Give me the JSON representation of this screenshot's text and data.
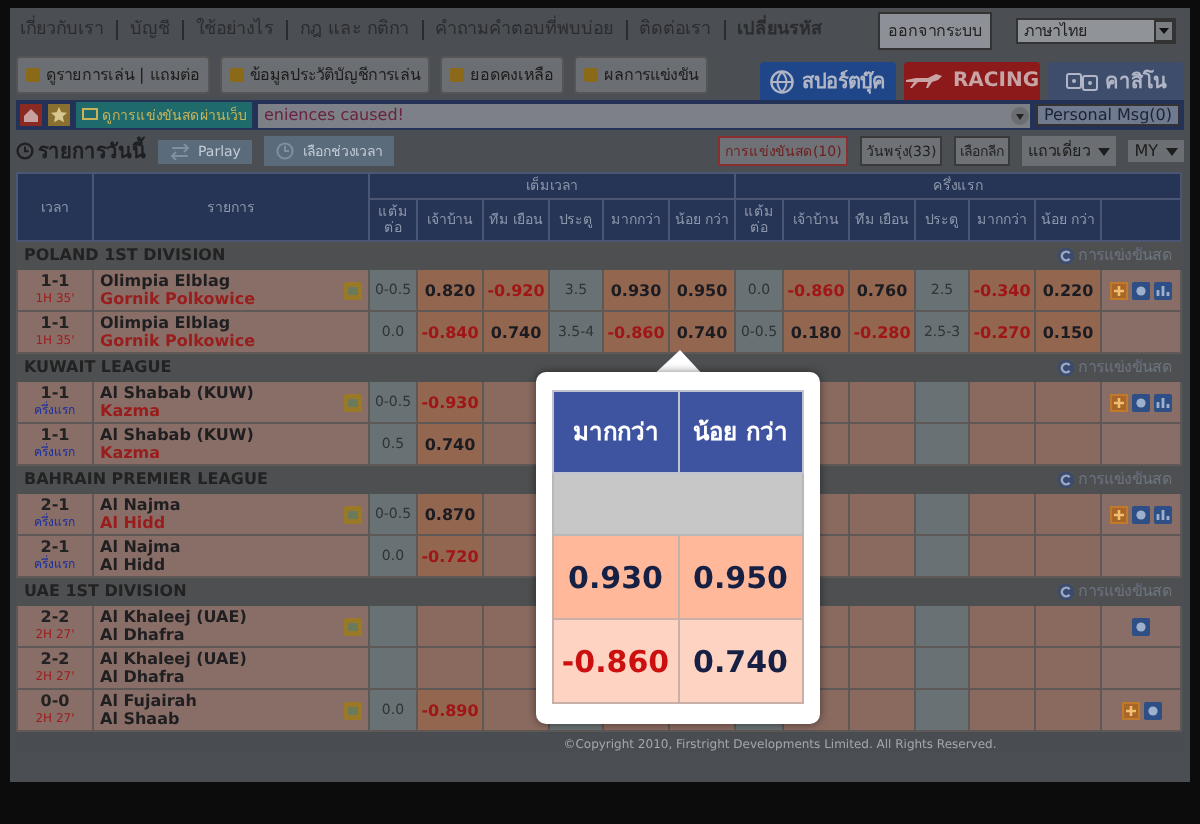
{
  "nav": {
    "links": [
      {
        "label": "เกี่ยวกับเรา",
        "selected": false
      },
      {
        "label": "บัญชี",
        "selected": false
      },
      {
        "label": "ใช้อย่างไร",
        "selected": false
      },
      {
        "label": "กฎ และ กติกา",
        "selected": false
      },
      {
        "label": "คำถามคำตอบที่พบบ่อย",
        "selected": false
      },
      {
        "label": "ติดต่อเรา",
        "selected": false
      },
      {
        "label": "เปลี่ยนรหัส",
        "selected": true
      }
    ],
    "logout": "ออกจากระบบ",
    "language": "ภาษาไทย"
  },
  "toolbar": {
    "buttons": [
      "ดูรายการเล่น | แถมต่อ",
      "ข้อมูลประวัติบัญชีการเล่น",
      "ยอดคงเหลือ",
      "ผลการแข่งขัน"
    ],
    "products": [
      {
        "kind": "sports",
        "label": "สปอร์ตบุ๊ค"
      },
      {
        "kind": "racing",
        "label": "RACING"
      },
      {
        "kind": "casino",
        "label": "คาสิโน"
      }
    ]
  },
  "ticker": {
    "live_button": "ดูการแข่งขันสดผ่านเว็บ",
    "message": "eniences caused!",
    "personal_msg": "Personal Msg(0)"
  },
  "filters": {
    "title": "รายการวันนี้",
    "tabs": [
      {
        "kind": "parlay",
        "label": "Parlay",
        "disabled": true
      },
      {
        "kind": "time",
        "label": "เลือกช่วงเวลา",
        "disabled": true
      }
    ],
    "buttons": [
      {
        "label": "การแข่งขันสด(10)",
        "selected": true
      },
      {
        "label": "วันพรุ่ง(33)",
        "selected": false
      },
      {
        "label": "เลือกลีก",
        "selected": false
      }
    ],
    "view_select": "แถวเดี่ยว",
    "odds_select": "MY"
  },
  "table": {
    "time_header": "เวลา",
    "event_header": "รายการ",
    "groups": [
      {
        "title": "เต็มเวลา",
        "columns": [
          "แต้ม ต่อ",
          "เจ้าบ้าน",
          "ทีม เยือน",
          "ประตู",
          "มากกว่า",
          "น้อย กว่า"
        ]
      },
      {
        "title": "ครึ่งแรก",
        "columns": [
          "แต้ม ต่อ",
          "เจ้าบ้าน",
          "ทีม เยือน",
          "ประตู",
          "มากกว่า",
          "น้อย กว่า"
        ]
      }
    ],
    "leagues": [
      {
        "name": "POLAND 1ST DIVISION",
        "live_label": "การแข่งขันสด",
        "matches": [
          {
            "score": "1-1",
            "time": "1H 35'",
            "live_clock": true,
            "teams": [
              {
                "name": "Olimpia Elblag",
                "favored": false
              },
              {
                "name": "Gornik Polkowice",
                "favored": true
              }
            ],
            "live_tv": true,
            "ft": {
              "hdp": "0-0.5",
              "home": "0.820",
              "away": "-0.920",
              "goal": "3.5",
              "over": "0.930",
              "under": "0.950"
            },
            "h1": {
              "hdp": "0.0",
              "home": "-0.860",
              "away": "0.760",
              "goal": "2.5",
              "over": "-0.340",
              "under": "0.220"
            },
            "actions": [
              {
                "kind": "plus"
              },
              {
                "kind": "coin"
              },
              {
                "kind": "chart"
              }
            ]
          },
          {
            "score": "1-1",
            "time": "1H 35'",
            "live_clock": true,
            "teams": [
              {
                "name": "Olimpia Elblag",
                "favored": false
              },
              {
                "name": "Gornik Polkowice",
                "favored": true
              }
            ],
            "live_tv": false,
            "ft": {
              "hdp": "0.0",
              "home": "-0.840",
              "away": "0.740",
              "goal": "3.5-4",
              "over": "-0.860",
              "under": "0.740"
            },
            "h1": {
              "hdp": "0-0.5",
              "home": "0.180",
              "away": "-0.280",
              "goal": "2.5-3",
              "over": "-0.270",
              "under": "0.150"
            }
          }
        ]
      },
      {
        "name": "KUWAIT LEAGUE",
        "live_label": "การแข่งขันสด",
        "matches": [
          {
            "score": "1-1",
            "time": "ครึ่งแรก",
            "live_clock": false,
            "teams": [
              {
                "name": "Al Shabab (KUW)",
                "favored": false
              },
              {
                "name": "Kazma",
                "favored": true
              }
            ],
            "live_tv": true,
            "ft": {
              "hdp": "0-0.5",
              "home": "-0.930"
            },
            "actions": [
              {
                "kind": "plus"
              },
              {
                "kind": "coin"
              },
              {
                "kind": "chart"
              }
            ]
          },
          {
            "score": "1-1",
            "time": "ครึ่งแรก",
            "live_clock": false,
            "teams": [
              {
                "name": "Al Shabab (KUW)",
                "favored": false
              },
              {
                "name": "Kazma",
                "favored": true
              }
            ],
            "live_tv": false,
            "ft": {
              "hdp": "0.5",
              "home": "0.740"
            }
          }
        ]
      },
      {
        "name": "BAHRAIN PREMIER LEAGUE",
        "live_label": "การแข่งขันสด",
        "matches": [
          {
            "score": "2-1",
            "time": "ครึ่งแรก",
            "live_clock": false,
            "teams": [
              {
                "name": "Al Najma",
                "favored": false
              },
              {
                "name": "Al Hidd",
                "favored": true
              }
            ],
            "live_tv": true,
            "ft": {
              "hdp": "0-0.5",
              "home": "0.870"
            },
            "actions": [
              {
                "kind": "plus"
              },
              {
                "kind": "coin"
              },
              {
                "kind": "chart"
              }
            ]
          },
          {
            "score": "2-1",
            "time": "ครึ่งแรก",
            "live_clock": false,
            "teams": [
              {
                "name": "Al Najma",
                "favored": false
              },
              {
                "name": "Al Hidd",
                "favored": false
              }
            ],
            "live_tv": false,
            "ft": {
              "hdp": "0.0",
              "home": "-0.720"
            }
          }
        ]
      },
      {
        "name": "UAE 1ST DIVISION",
        "live_label": "การแข่งขันสด",
        "matches": [
          {
            "score": "2-2",
            "time": "2H 27'",
            "live_clock": true,
            "teams": [
              {
                "name": "Al Khaleej (UAE)",
                "favored": false
              },
              {
                "name": "Al Dhafra",
                "favored": false
              }
            ],
            "live_tv": true,
            "actions": [
              {
                "kind": "coin"
              }
            ]
          },
          {
            "score": "2-2",
            "time": "2H 27'",
            "live_clock": true,
            "teams": [
              {
                "name": "Al Khaleej (UAE)",
                "favored": false
              },
              {
                "name": "Al Dhafra",
                "favored": false
              }
            ],
            "live_tv": false
          },
          {
            "score": "0-0",
            "time": "2H 27'",
            "live_clock": true,
            "teams": [
              {
                "name": "Al Fujairah",
                "favored": false
              },
              {
                "name": "Al Shaab",
                "favored": false
              }
            ],
            "live_tv": true,
            "ft": {
              "hdp": "0.0",
              "home": "-0.890"
            },
            "actions": [
              {
                "kind": "plus"
              },
              {
                "kind": "coin"
              }
            ]
          }
        ]
      }
    ]
  },
  "zoom_callout": {
    "headers": [
      "มากกว่า",
      "น้อย กว่า"
    ],
    "rows": [
      [
        "0.930",
        "0.950"
      ],
      [
        "-0.860",
        "0.740"
      ]
    ]
  },
  "footer": "©Copyright 2010, Firstright Developments Limited. All Rights Reserved."
}
